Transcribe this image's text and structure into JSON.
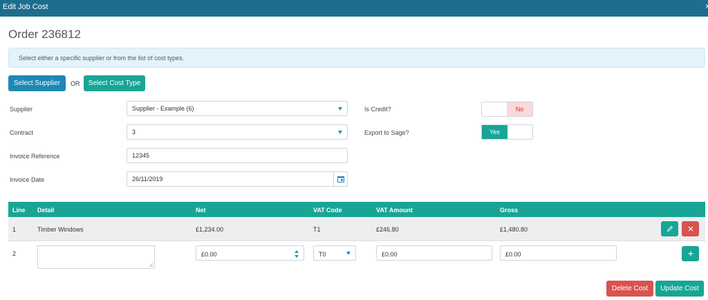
{
  "window": {
    "title": "Edit Job Cost",
    "close_glyph": "x"
  },
  "order_title": "Order 236812",
  "info": "Select either a specific supplier or from the list of cost types.",
  "buttons": {
    "select_supplier": "Select Supplier",
    "or": "OR",
    "select_cost_type": "Select Cost Type",
    "delete_cost": "Delete Cost",
    "update_cost": "Update Cost"
  },
  "form": {
    "supplier": {
      "label": "Supplier",
      "value": "Supplier - Example (6)"
    },
    "contract": {
      "label": "Contract",
      "value": "3"
    },
    "invoice_reference": {
      "label": "Invoice Reference",
      "value": "12345"
    },
    "invoice_date": {
      "label": "Invoice Date",
      "value": "26/11/2019"
    },
    "is_credit": {
      "label": "Is Credit?",
      "value": "No"
    },
    "export_to_sage": {
      "label": "Export to Sage?",
      "value": "Yes"
    }
  },
  "table": {
    "headers": [
      "Line",
      "Detail",
      "Net",
      "VAT Code",
      "VAT Amount",
      "Gross"
    ],
    "rows": [
      {
        "line": "1",
        "detail": "Timber Windows",
        "net": "£1,234.00",
        "vat_code": "T1",
        "vat_amount": "£246.80",
        "gross": "£1,480.80"
      }
    ],
    "new_row": {
      "line": "2",
      "detail": "",
      "net": "£0.00",
      "vat_code": "T0",
      "vat_amount": "£0.00",
      "gross": "£0.00"
    }
  },
  "icons": [
    "close-icon",
    "chevron-down-icon",
    "calendar-icon",
    "pencil-icon",
    "x-icon",
    "plus-icon",
    "spinner-up-icon",
    "spinner-down-icon",
    "resize-grip-icon"
  ],
  "colors": {
    "header": "#1d6e8e",
    "teal": "#18a596",
    "blue": "#1e88b5",
    "red": "#d9534f",
    "info_bg": "#e3f2fb"
  }
}
